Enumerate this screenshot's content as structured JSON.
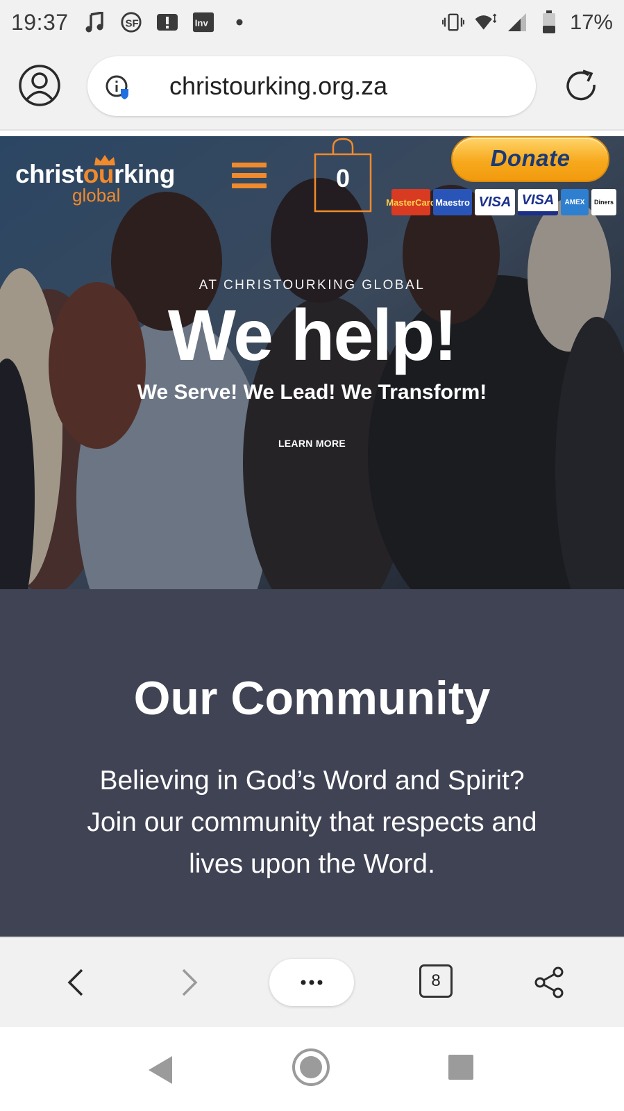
{
  "status_bar": {
    "time": "19:37",
    "battery_percent": "17%",
    "notification_icons": [
      "music-note-icon",
      "sf-icon",
      "alert-icon",
      "inv-icon",
      "dot-icon"
    ],
    "system_icons": [
      "vibrate-icon",
      "wifi-icon",
      "signal-icon",
      "battery-icon"
    ]
  },
  "browser": {
    "url": "christourking.org.za",
    "open_tabs": "8"
  },
  "site": {
    "logo_prefix": "christ",
    "logo_highlight": "ou",
    "logo_suffix": "rking",
    "logo_sub": "global",
    "cart_count": "0",
    "donate_label": "Donate",
    "payment_cards": [
      "MasterCard",
      "Maestro",
      "VISA",
      "VISA",
      "AMEX",
      "Diners"
    ]
  },
  "hero": {
    "kicker": "AT CHRISTOURKING GLOBAL",
    "title": "We help!",
    "subtitle": "We Serve! We Lead! We Transform!",
    "learn_more": "LEARN MORE"
  },
  "community": {
    "title": "Our Community",
    "body": "Believing in God’s Word and Spirit? Join our community that respects and lives upon the Word."
  },
  "colors": {
    "accent_orange": "#f08a2c",
    "community_bg": "#404354",
    "chrome_bg": "#f1f1f1",
    "donate_text": "#1b3a75"
  }
}
